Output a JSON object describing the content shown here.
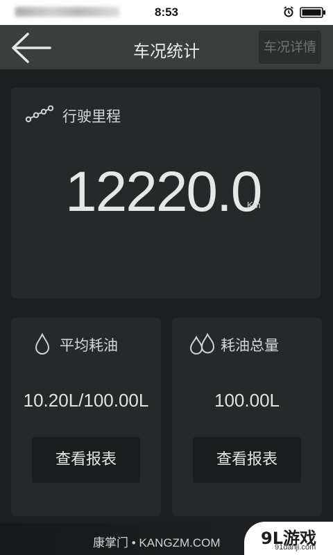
{
  "status_bar": {
    "time": "8:53",
    "icons": [
      "alarm-icon",
      "battery-icon"
    ]
  },
  "nav": {
    "back_icon": "arrow-left-icon",
    "title": "车况统计",
    "detail_button": "车况详情"
  },
  "mileage": {
    "icon": "link-chain-icon",
    "label": "行驶里程",
    "value": "12220.0",
    "unit": "Km"
  },
  "avg_fuel": {
    "icon": "drop-icon",
    "label": "平均耗油",
    "value": "10.20L/100.00L",
    "button": "查看报表"
  },
  "total_fuel": {
    "icon": "double-drop-icon",
    "label": "耗油总量",
    "value": "100.00L",
    "button": "查看报表"
  },
  "watermark": {
    "text": "康掌门 • KANGZM.COM",
    "logo_main": "9L游戏",
    "logo_sub": "91danji.com"
  },
  "colors": {
    "background": "#1c1f20",
    "card": "#25292a",
    "nav_bar": "#3a3f3d",
    "text": "#d4d8d8"
  }
}
